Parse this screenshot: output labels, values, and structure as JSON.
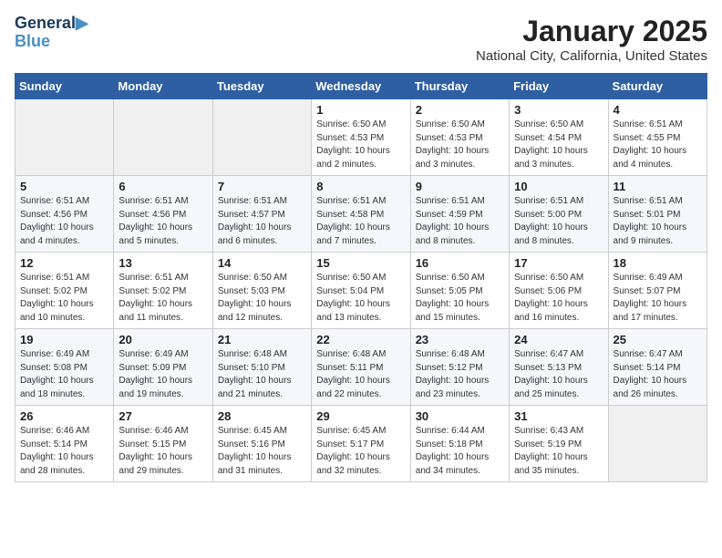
{
  "logo": {
    "line1": "General",
    "line2": "Blue"
  },
  "title": "January 2025",
  "location": "National City, California, United States",
  "weekdays": [
    "Sunday",
    "Monday",
    "Tuesday",
    "Wednesday",
    "Thursday",
    "Friday",
    "Saturday"
  ],
  "weeks": [
    [
      {
        "day": "",
        "content": ""
      },
      {
        "day": "",
        "content": ""
      },
      {
        "day": "",
        "content": ""
      },
      {
        "day": "1",
        "content": "Sunrise: 6:50 AM\nSunset: 4:53 PM\nDaylight: 10 hours\nand 2 minutes."
      },
      {
        "day": "2",
        "content": "Sunrise: 6:50 AM\nSunset: 4:53 PM\nDaylight: 10 hours\nand 3 minutes."
      },
      {
        "day": "3",
        "content": "Sunrise: 6:50 AM\nSunset: 4:54 PM\nDaylight: 10 hours\nand 3 minutes."
      },
      {
        "day": "4",
        "content": "Sunrise: 6:51 AM\nSunset: 4:55 PM\nDaylight: 10 hours\nand 4 minutes."
      }
    ],
    [
      {
        "day": "5",
        "content": "Sunrise: 6:51 AM\nSunset: 4:56 PM\nDaylight: 10 hours\nand 4 minutes."
      },
      {
        "day": "6",
        "content": "Sunrise: 6:51 AM\nSunset: 4:56 PM\nDaylight: 10 hours\nand 5 minutes."
      },
      {
        "day": "7",
        "content": "Sunrise: 6:51 AM\nSunset: 4:57 PM\nDaylight: 10 hours\nand 6 minutes."
      },
      {
        "day": "8",
        "content": "Sunrise: 6:51 AM\nSunset: 4:58 PM\nDaylight: 10 hours\nand 7 minutes."
      },
      {
        "day": "9",
        "content": "Sunrise: 6:51 AM\nSunset: 4:59 PM\nDaylight: 10 hours\nand 8 minutes."
      },
      {
        "day": "10",
        "content": "Sunrise: 6:51 AM\nSunset: 5:00 PM\nDaylight: 10 hours\nand 8 minutes."
      },
      {
        "day": "11",
        "content": "Sunrise: 6:51 AM\nSunset: 5:01 PM\nDaylight: 10 hours\nand 9 minutes."
      }
    ],
    [
      {
        "day": "12",
        "content": "Sunrise: 6:51 AM\nSunset: 5:02 PM\nDaylight: 10 hours\nand 10 minutes."
      },
      {
        "day": "13",
        "content": "Sunrise: 6:51 AM\nSunset: 5:02 PM\nDaylight: 10 hours\nand 11 minutes."
      },
      {
        "day": "14",
        "content": "Sunrise: 6:50 AM\nSunset: 5:03 PM\nDaylight: 10 hours\nand 12 minutes."
      },
      {
        "day": "15",
        "content": "Sunrise: 6:50 AM\nSunset: 5:04 PM\nDaylight: 10 hours\nand 13 minutes."
      },
      {
        "day": "16",
        "content": "Sunrise: 6:50 AM\nSunset: 5:05 PM\nDaylight: 10 hours\nand 15 minutes."
      },
      {
        "day": "17",
        "content": "Sunrise: 6:50 AM\nSunset: 5:06 PM\nDaylight: 10 hours\nand 16 minutes."
      },
      {
        "day": "18",
        "content": "Sunrise: 6:49 AM\nSunset: 5:07 PM\nDaylight: 10 hours\nand 17 minutes."
      }
    ],
    [
      {
        "day": "19",
        "content": "Sunrise: 6:49 AM\nSunset: 5:08 PM\nDaylight: 10 hours\nand 18 minutes."
      },
      {
        "day": "20",
        "content": "Sunrise: 6:49 AM\nSunset: 5:09 PM\nDaylight: 10 hours\nand 19 minutes."
      },
      {
        "day": "21",
        "content": "Sunrise: 6:48 AM\nSunset: 5:10 PM\nDaylight: 10 hours\nand 21 minutes."
      },
      {
        "day": "22",
        "content": "Sunrise: 6:48 AM\nSunset: 5:11 PM\nDaylight: 10 hours\nand 22 minutes."
      },
      {
        "day": "23",
        "content": "Sunrise: 6:48 AM\nSunset: 5:12 PM\nDaylight: 10 hours\nand 23 minutes."
      },
      {
        "day": "24",
        "content": "Sunrise: 6:47 AM\nSunset: 5:13 PM\nDaylight: 10 hours\nand 25 minutes."
      },
      {
        "day": "25",
        "content": "Sunrise: 6:47 AM\nSunset: 5:14 PM\nDaylight: 10 hours\nand 26 minutes."
      }
    ],
    [
      {
        "day": "26",
        "content": "Sunrise: 6:46 AM\nSunset: 5:14 PM\nDaylight: 10 hours\nand 28 minutes."
      },
      {
        "day": "27",
        "content": "Sunrise: 6:46 AM\nSunset: 5:15 PM\nDaylight: 10 hours\nand 29 minutes."
      },
      {
        "day": "28",
        "content": "Sunrise: 6:45 AM\nSunset: 5:16 PM\nDaylight: 10 hours\nand 31 minutes."
      },
      {
        "day": "29",
        "content": "Sunrise: 6:45 AM\nSunset: 5:17 PM\nDaylight: 10 hours\nand 32 minutes."
      },
      {
        "day": "30",
        "content": "Sunrise: 6:44 AM\nSunset: 5:18 PM\nDaylight: 10 hours\nand 34 minutes."
      },
      {
        "day": "31",
        "content": "Sunrise: 6:43 AM\nSunset: 5:19 PM\nDaylight: 10 hours\nand 35 minutes."
      },
      {
        "day": "",
        "content": ""
      }
    ]
  ]
}
